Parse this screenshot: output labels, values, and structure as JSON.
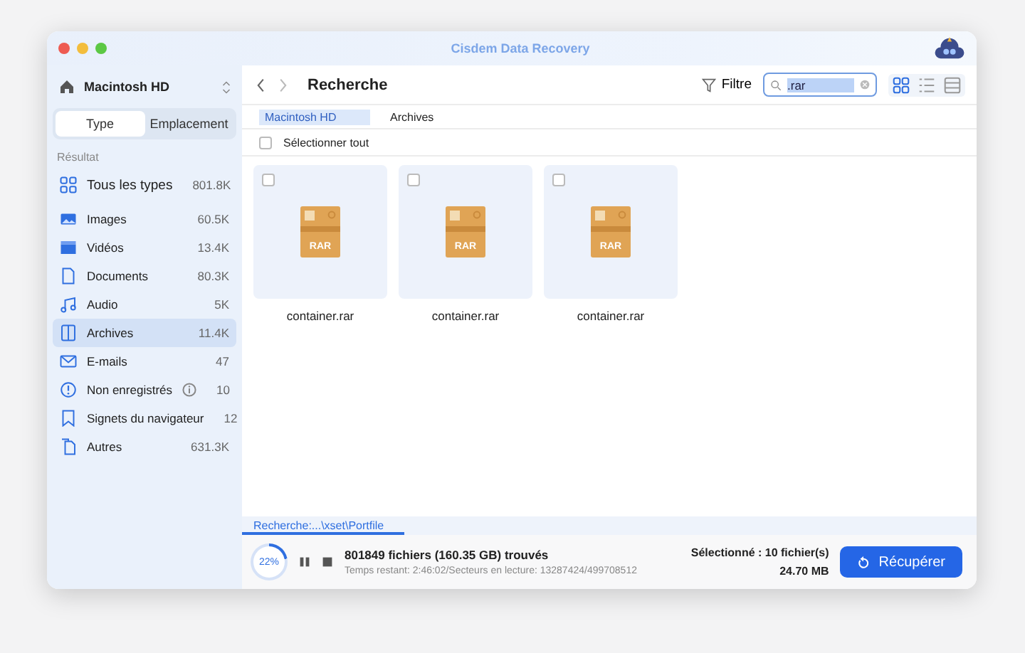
{
  "window": {
    "title": "Cisdem Data Recovery"
  },
  "sidebar": {
    "drive": "Macintosh  HD",
    "tabs": [
      {
        "label": "Type",
        "selected": true
      },
      {
        "label": "Emplacement",
        "selected": false
      }
    ],
    "section": "Résultat",
    "items": [
      {
        "label": "Tous les types",
        "count": "801.8K",
        "selected": false,
        "info": false
      },
      {
        "label": "Images",
        "count": "60.5K",
        "selected": false,
        "info": false
      },
      {
        "label": "Vidéos",
        "count": "13.4K",
        "selected": false,
        "info": false
      },
      {
        "label": "Documents",
        "count": "80.3K",
        "selected": false,
        "info": false
      },
      {
        "label": "Audio",
        "count": "5K",
        "selected": false,
        "info": false
      },
      {
        "label": "Archives",
        "count": "11.4K",
        "selected": true,
        "info": false
      },
      {
        "label": "E-mails",
        "count": "47",
        "selected": false,
        "info": false
      },
      {
        "label": "Non enregistrés",
        "count": "10",
        "selected": false,
        "info": true
      },
      {
        "label": "Signets du navigateur",
        "count": "12",
        "selected": false,
        "info": false
      },
      {
        "label": "Autres",
        "count": "631.3K",
        "selected": false,
        "info": false
      }
    ]
  },
  "toolbar": {
    "title": "Recherche",
    "filter": "Filtre",
    "search": {
      "value": ".rar"
    },
    "views": [
      {
        "selected": true
      },
      {
        "selected": false
      },
      {
        "selected": false
      }
    ]
  },
  "breadcrumb": [
    {
      "label": "Macintosh  HD",
      "selected": true
    },
    {
      "label": "Archives",
      "selected": false
    }
  ],
  "select_all": {
    "label": "Sélectionner tout",
    "checked": false
  },
  "files": [
    {
      "name": "container.rar",
      "badge": "RAR",
      "checked": false
    },
    {
      "name": "container.rar",
      "badge": "RAR",
      "checked": false
    },
    {
      "name": "container.rar",
      "badge": "RAR",
      "checked": false
    }
  ],
  "status": {
    "path": "Recherche:...\\xset\\Portfile",
    "level": 0.22,
    "percent": "22%",
    "found": "801849 fichiers (160.35 GB) trouvés",
    "detail": "Temps restant: 2:46:02/Secteurs en lecture: 13287424/499708512",
    "selected": "Sélectionné : 10 fichier(s)",
    "size": "24.70 MB",
    "button": "Récupérer"
  }
}
